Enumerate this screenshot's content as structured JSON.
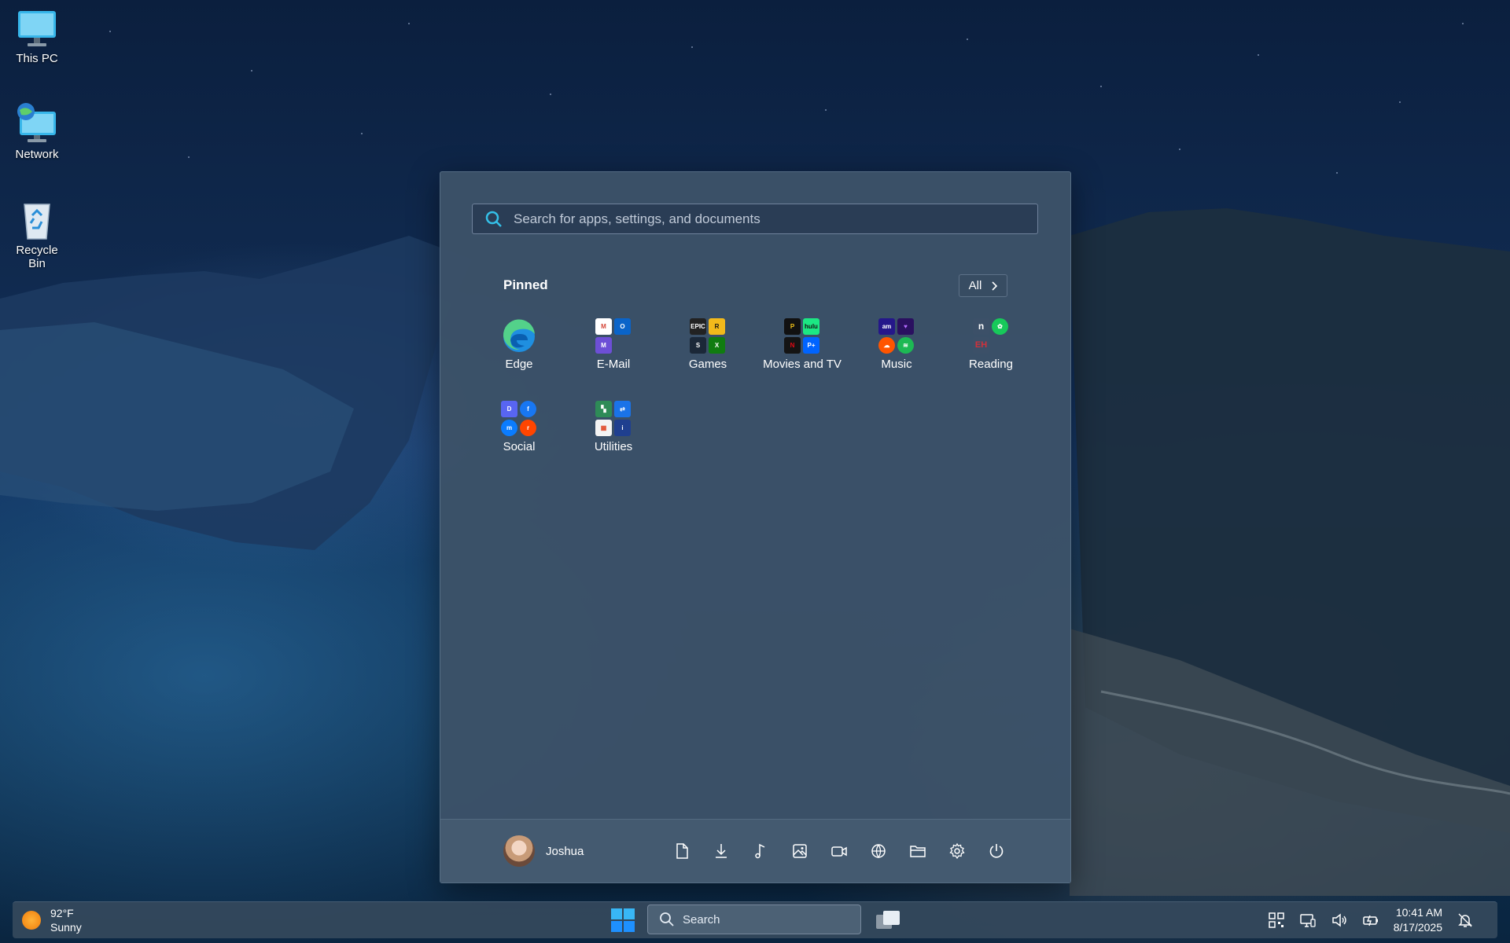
{
  "desktop": {
    "icons": [
      {
        "label": "This PC",
        "icon": "monitor-icon"
      },
      {
        "label": "Network",
        "icon": "network-globe-icon"
      },
      {
        "label": "Recycle Bin",
        "icon": "recycle-bin-icon"
      }
    ]
  },
  "start_menu": {
    "search_placeholder": "Search for apps, settings, and documents",
    "pinned_label": "Pinned",
    "all_label": "All",
    "pinned": [
      {
        "label": "Edge",
        "icon": "edge-icon"
      },
      {
        "label": "E-Mail",
        "icon": "email-folder-icon"
      },
      {
        "label": "Games",
        "icon": "games-folder-icon"
      },
      {
        "label": "Movies and TV",
        "icon": "movies-folder-icon"
      },
      {
        "label": "Music",
        "icon": "music-folder-icon"
      },
      {
        "label": "Reading",
        "icon": "reading-folder-icon"
      },
      {
        "label": "Social",
        "icon": "social-folder-icon"
      },
      {
        "label": "Utilities",
        "icon": "utilities-folder-icon"
      }
    ],
    "user_name": "Joshua",
    "footer_icons": [
      "documents-icon",
      "downloads-icon",
      "music-icon",
      "pictures-icon",
      "videos-icon",
      "network-icon",
      "file-explorer-icon",
      "settings-icon",
      "power-icon"
    ]
  },
  "taskbar": {
    "weather_temp": "92°F",
    "weather_desc": "Sunny",
    "search_label": "Search",
    "time": "10:41 AM",
    "date": "8/17/2025",
    "colors": {
      "accent": "#1e90ff",
      "taskbar": "#34485c"
    }
  }
}
